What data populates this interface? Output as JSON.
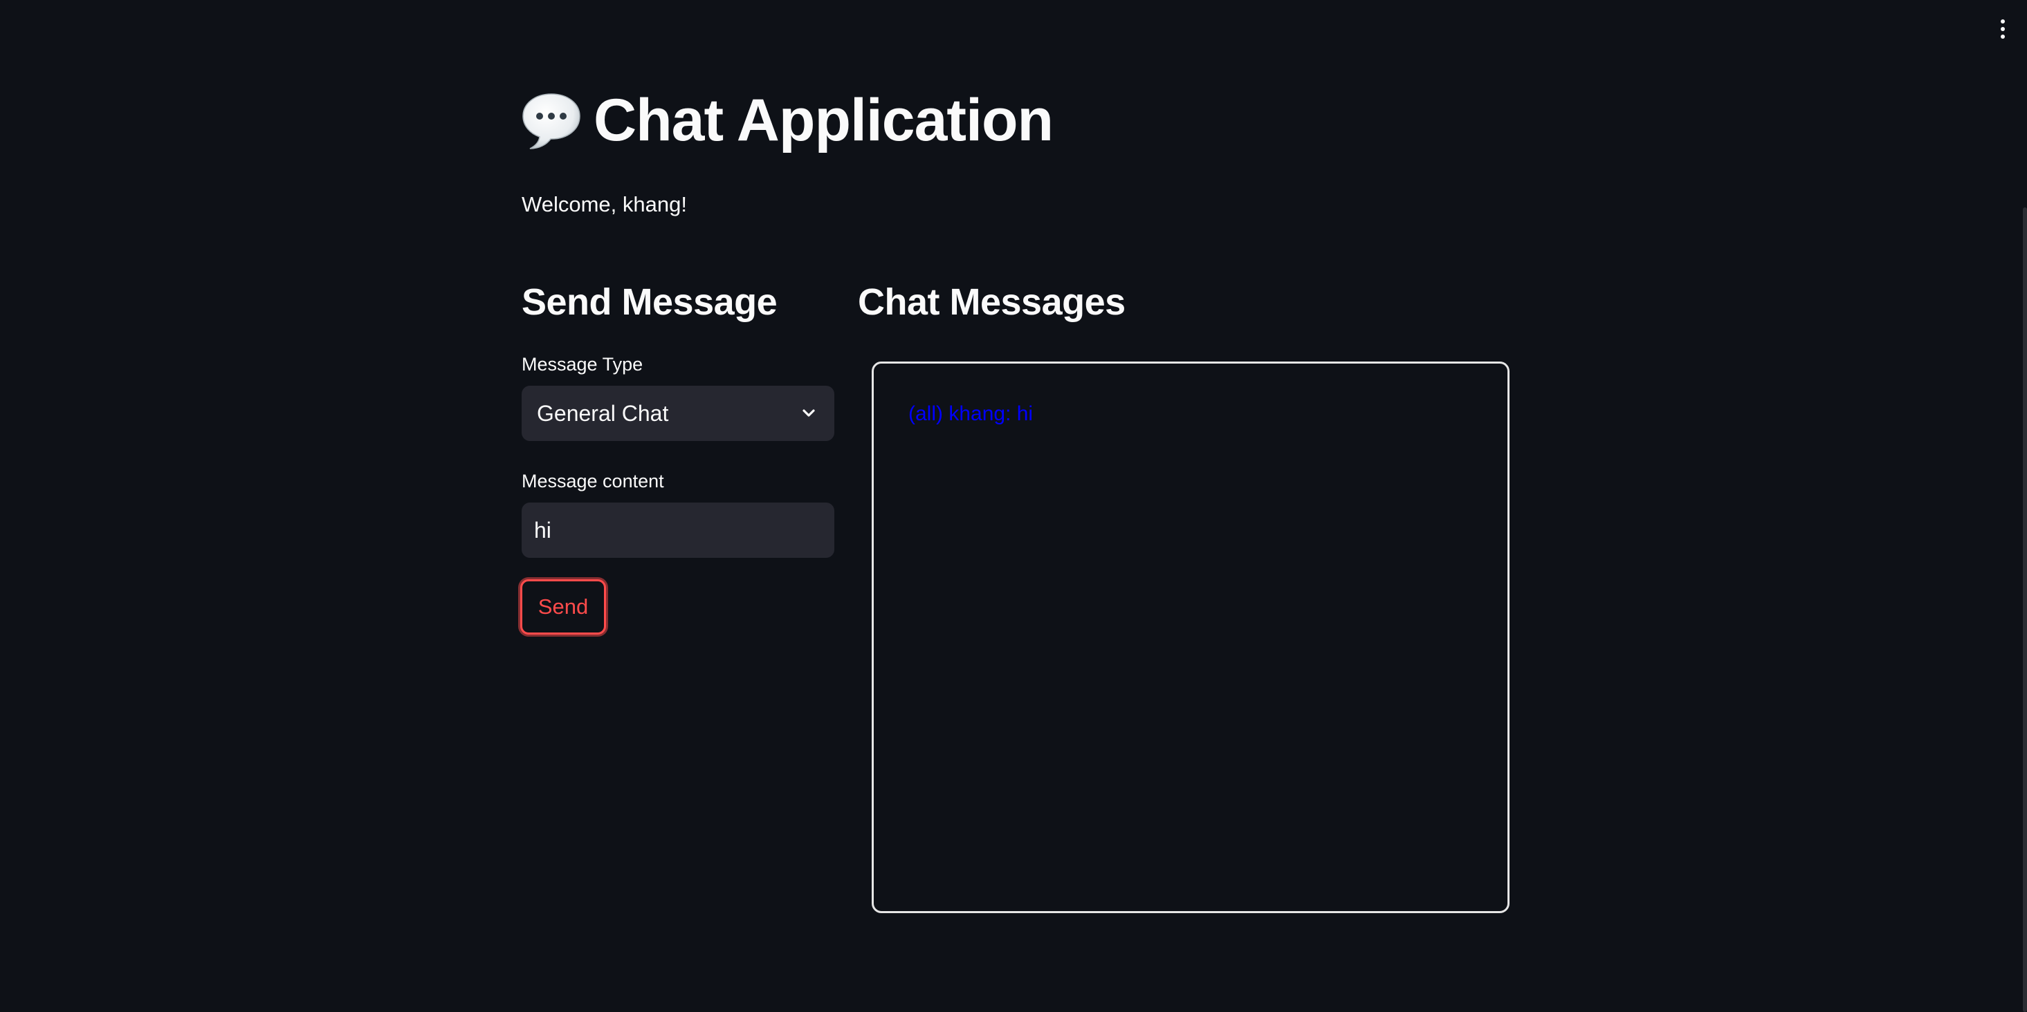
{
  "header": {
    "menu_icon": "kebab-menu-icon"
  },
  "main": {
    "title_icon": "speech-bubble-icon",
    "title": "Chat Application",
    "welcome": "Welcome, khang!"
  },
  "send_panel": {
    "heading": "Send Message",
    "message_type_label": "Message Type",
    "message_type_value": "General Chat",
    "message_content_label": "Message content",
    "message_content_value": "hi",
    "send_label": "Send"
  },
  "chat_panel": {
    "heading": "Chat Messages",
    "messages": [
      {
        "text": "(all) khang: hi",
        "color": "#0000ff"
      }
    ]
  },
  "colors": {
    "background": "#0e1117",
    "input_background": "#262730",
    "accent": "#ff4b4b",
    "text": "#fafafa"
  }
}
